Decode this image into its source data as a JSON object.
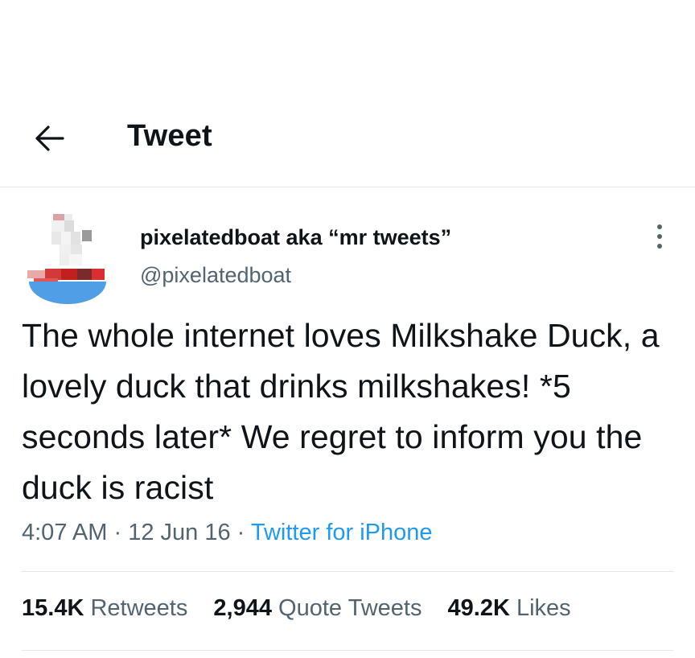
{
  "header": {
    "back_icon": "arrow-left-icon",
    "title": "Tweet"
  },
  "author": {
    "avatar_icon": "pixelated-boat-avatar",
    "display_name": "pixelatedboat aka “mr tweets”",
    "handle": "@pixelatedboat"
  },
  "more_icon": "vertical-ellipsis-icon",
  "tweet": {
    "text": "The whole internet loves Milkshake Duck, a lovely duck that drinks milkshakes! *5 seconds later* We regret to inform you the duck is racist",
    "time": "4:07 AM",
    "date": "12 Jun 16",
    "separator": "·",
    "source": "Twitter for iPhone"
  },
  "stats": {
    "retweets": {
      "value": "15.4K",
      "label": "Retweets"
    },
    "quote_tweets": {
      "value": "2,944",
      "label": "Quote Tweets"
    },
    "likes": {
      "value": "49.2K",
      "label": "Likes"
    }
  },
  "colors": {
    "text": "#0f1419",
    "secondary": "#536471",
    "link": "#1d9bf0",
    "divider": "#e4e8eb"
  }
}
